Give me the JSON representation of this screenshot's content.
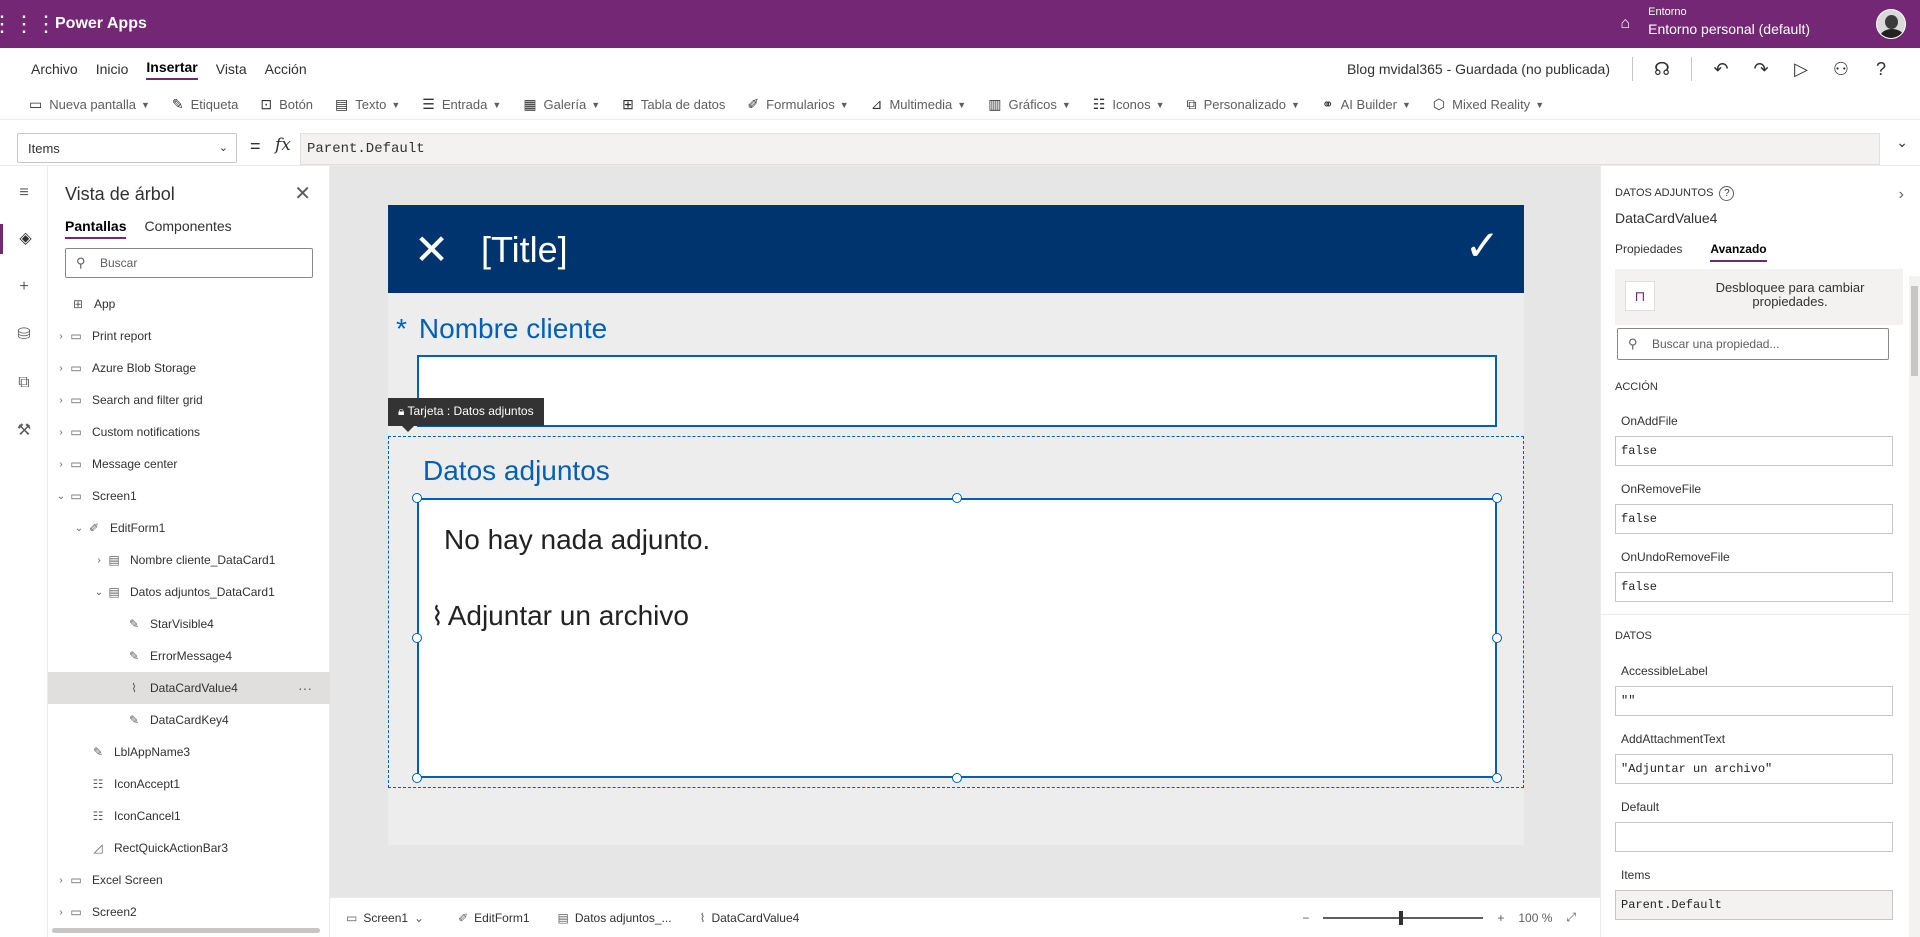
{
  "app": {
    "name": "Power Apps"
  },
  "env": {
    "label": "Entorno",
    "value": "Entorno personal (default)"
  },
  "menu": {
    "items": [
      "Archivo",
      "Inicio",
      "Insertar",
      "Vista",
      "Acción"
    ],
    "status": "Blog mvidal365 - Guardada (no publicada)"
  },
  "ribbon": {
    "items": [
      "Nueva pantalla",
      "Etiqueta",
      "Botón",
      "Texto",
      "Entrada",
      "Galería",
      "Tabla de datos",
      "Formularios",
      "Multimedia",
      "Gráficos",
      "Iconos",
      "Personalizado",
      "AI Builder",
      "Mixed Reality"
    ]
  },
  "formula": {
    "property": "Items",
    "eq": "=",
    "fx": "fx",
    "value": "Parent.Default"
  },
  "tree": {
    "title": "Vista de árbol",
    "tabs": [
      "Pantallas",
      "Componentes"
    ],
    "search_placeholder": "Buscar",
    "items": [
      "App",
      "Print report",
      "Azure Blob Storage",
      "Search and filter grid",
      "Custom notifications",
      "Message center",
      "Screen1",
      "EditForm1",
      "Nombre cliente_DataCard1",
      "Datos adjuntos_DataCard1",
      "StarVisible4",
      "ErrorMessage4",
      "DataCardValue4",
      "DataCardKey4",
      "LblAppName3",
      "IconAccept1",
      "IconCancel1",
      "RectQuickActionBar3",
      "Excel Screen",
      "Screen2"
    ]
  },
  "canvas": {
    "title": "[Title]",
    "star": "*",
    "field1_label": "Nombre cliente",
    "tag": "Tarjeta : Datos adjuntos",
    "field2_label": "Datos adjuntos",
    "no_attachments": "No hay nada adjunto.",
    "add_attachment": "Adjuntar un archivo"
  },
  "breadcrumb": [
    "Screen1",
    "EditForm1",
    "Datos adjuntos_...",
    "DataCardValue4"
  ],
  "zoom": {
    "minus": "−",
    "plus": "+",
    "value": "100 %"
  },
  "props": {
    "type_label": "DATOS ADJUNTOS",
    "control_name": "DataCardValue4",
    "tabs": [
      "Propiedades",
      "Avanzado"
    ],
    "lock_text": "Desbloquee para cambiar propiedades.",
    "search_placeholder": "Buscar una propiedad...",
    "section_action": "ACCIÓN",
    "section_data": "DATOS",
    "on_add_file": {
      "label": "OnAddFile",
      "value": "false"
    },
    "on_remove_file": {
      "label": "OnRemoveFile",
      "value": "false"
    },
    "on_undo_remove_file": {
      "label": "OnUndoRemoveFile",
      "value": "false"
    },
    "accessible_label": {
      "label": "AccessibleLabel",
      "value": "\"\""
    },
    "add_attachment_text": {
      "label": "AddAttachmentText",
      "value": "\"Adjuntar un archivo\""
    },
    "default": {
      "label": "Default",
      "value": ""
    },
    "items_prop": {
      "label": "Items",
      "value": "Parent.Default"
    }
  }
}
